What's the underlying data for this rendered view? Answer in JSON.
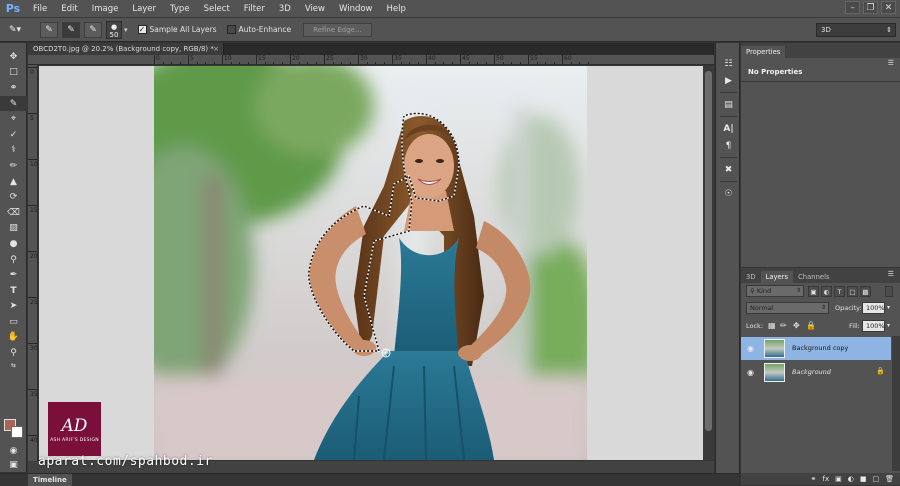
{
  "app": {
    "logo_label": "Ps",
    "menu": [
      "File",
      "Edit",
      "Image",
      "Layer",
      "Type",
      "Select",
      "Filter",
      "3D",
      "View",
      "Window",
      "Help"
    ]
  },
  "options_bar": {
    "brush_size": "50",
    "sample_all_layers_label": "Sample All Layers",
    "sample_all_layers_checked": true,
    "auto_enhance_label": "Auto-Enhance",
    "auto_enhance_checked": false,
    "refine_edge_label": "Refine Edge...",
    "workspace_value": "3D"
  },
  "document": {
    "tab_title": "OBCD2T0.jpg @ 20.2% (Background copy, RGB/8) *",
    "ruler_top_labels": [
      "0",
      "5",
      "10",
      "15",
      "20",
      "25",
      "30",
      "35",
      "40",
      "45",
      "50",
      "55",
      "60"
    ],
    "ruler_left_labels": [
      "0",
      "5",
      "10",
      "15",
      "20",
      "25",
      "30",
      "35",
      "40"
    ]
  },
  "overlay": {
    "logo_monogram": "AD",
    "logo_subtitle": "ASH ARIF'S DESIGN",
    "watermark": "aparat.com/spahbod.ir"
  },
  "timeline": {
    "tab_label": "Timeline"
  },
  "properties_panel": {
    "tab_label": "Properties",
    "content": "No Properties"
  },
  "layers_panel": {
    "tabs": [
      "3D",
      "Layers",
      "Channels"
    ],
    "active_tab": "Layers",
    "filter_kind": "Kind",
    "blend_mode": "Normal",
    "opacity_label": "Opacity:",
    "opacity_value": "100%",
    "lock_label": "Lock:",
    "fill_label": "Fill:",
    "fill_value": "100%",
    "layers": [
      {
        "name": "Background copy",
        "selected": true,
        "locked": false
      },
      {
        "name": "Background",
        "selected": false,
        "locked": true
      }
    ]
  },
  "colors": {
    "foreground": "#a96657",
    "background": "#ffffff",
    "selected_layer": "#8db4e2",
    "logo_bg": "#7a0f3a"
  }
}
